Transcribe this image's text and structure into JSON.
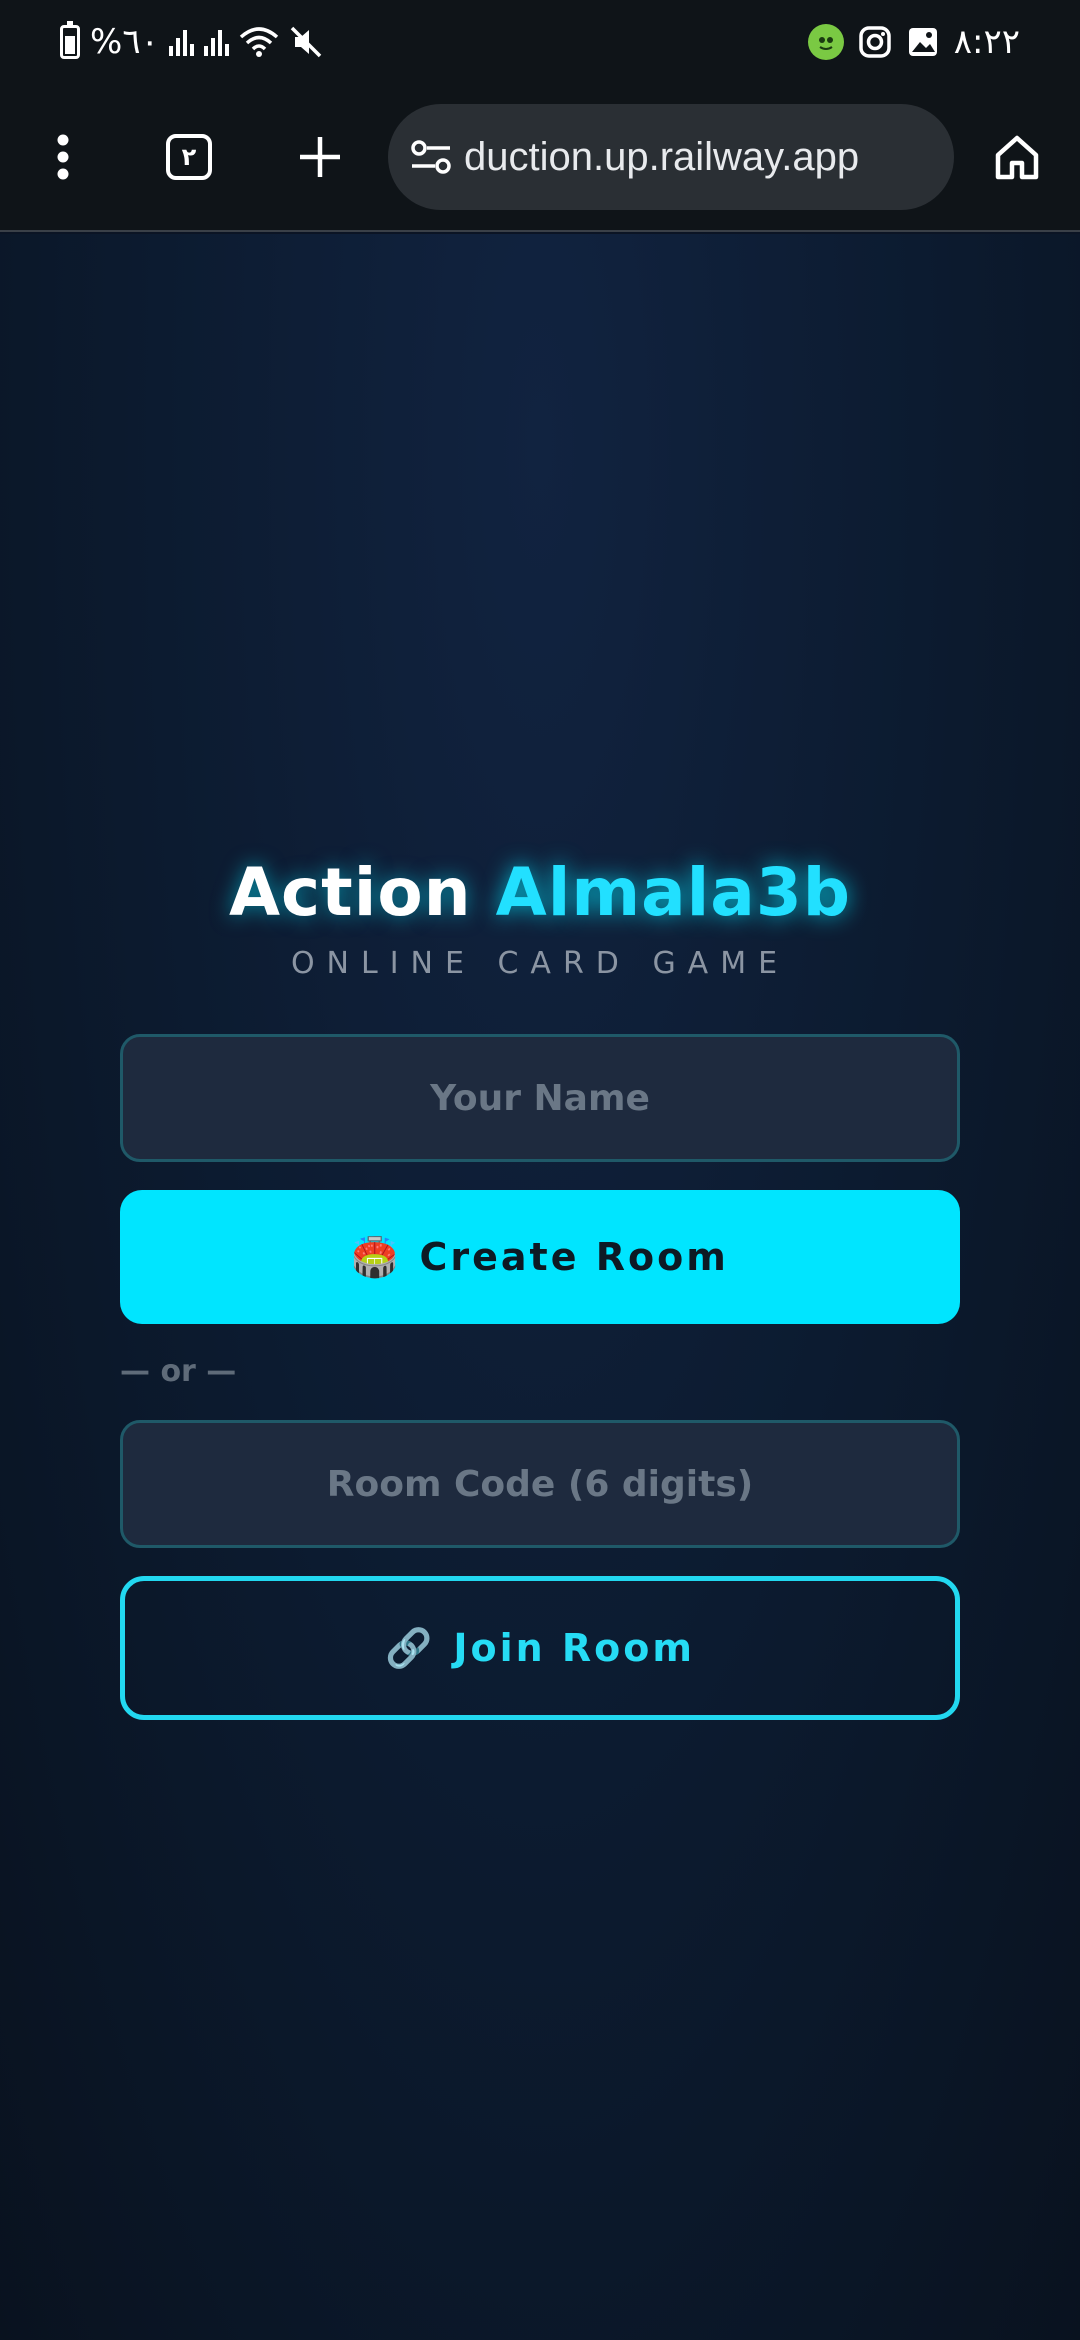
{
  "status_bar": {
    "battery_text": "%٦٠",
    "time": "٨:٢٢",
    "icons": [
      "battery-icon",
      "signal-icon",
      "signal-icon",
      "wifi-icon",
      "mute-icon",
      "app-notification-icon",
      "instagram-icon",
      "gallery-icon"
    ]
  },
  "browser": {
    "tab_count": "٢",
    "url": "duction.up.railway.app"
  },
  "page": {
    "title_part1": "Action",
    "title_part2": "Almala3b",
    "subtitle": "ONLINE CARD GAME",
    "name_placeholder": "Your Name",
    "create_icon": "🏟️",
    "create_label": "Create Room",
    "or_text": "— or —",
    "room_code_placeholder": "Room Code (6 digits)",
    "join_icon": "🔗",
    "join_label": "Join Room"
  },
  "colors": {
    "accent": "#00e5ff",
    "background": "#0b1424",
    "input_bg": "#1e2a3e"
  }
}
